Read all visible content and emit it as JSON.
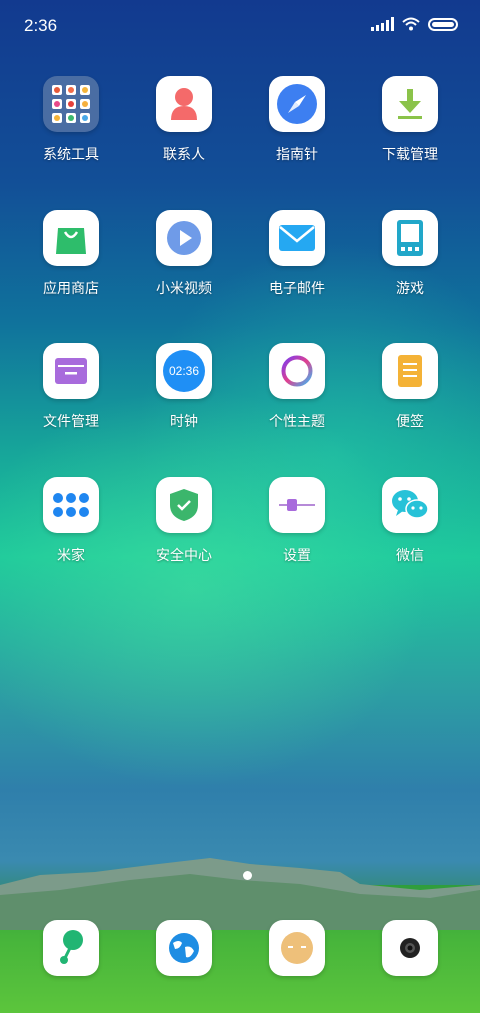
{
  "status_bar": {
    "time": "2:36"
  },
  "apps": [
    {
      "label": "系统工具",
      "icon": "folder-icon"
    },
    {
      "label": "联系人",
      "icon": "contacts-icon"
    },
    {
      "label": "指南针",
      "icon": "compass-icon"
    },
    {
      "label": "下载管理",
      "icon": "download-icon"
    },
    {
      "label": "应用商店",
      "icon": "app-store-icon"
    },
    {
      "label": "小米视频",
      "icon": "video-play-icon"
    },
    {
      "label": "电子邮件",
      "icon": "mail-icon"
    },
    {
      "label": "游戏",
      "icon": "game-console-icon"
    },
    {
      "label": "文件管理",
      "icon": "file-manager-icon"
    },
    {
      "label": "时钟",
      "icon": "clock-icon",
      "clock_text": "02:36"
    },
    {
      "label": "个性主题",
      "icon": "themes-ring-icon"
    },
    {
      "label": "便签",
      "icon": "notes-icon"
    },
    {
      "label": "米家",
      "icon": "mi-home-icon"
    },
    {
      "label": "安全中心",
      "icon": "shield-check-icon"
    },
    {
      "label": "设置",
      "icon": "settings-slider-icon"
    },
    {
      "label": "微信",
      "icon": "wechat-icon"
    }
  ],
  "dock": [
    {
      "icon": "maps-pin-icon"
    },
    {
      "icon": "browser-globe-icon"
    },
    {
      "icon": "messaging-face-icon"
    },
    {
      "icon": "camera-icon"
    }
  ],
  "colors": {
    "contacts": "#f46a6a",
    "compass": "#3d7ff1",
    "download": "#8bc34a",
    "app_store": "#2ebd6b",
    "video": "#6f9be8",
    "mail": "#25a8f2",
    "game": "#21a7c9",
    "file_manager": "#a86bdc",
    "clock": "#1f8ff5",
    "notes": "#f4b236",
    "mi_home": "#1f86f0",
    "security": "#3bb66c",
    "wechat": "#27c2d8"
  }
}
